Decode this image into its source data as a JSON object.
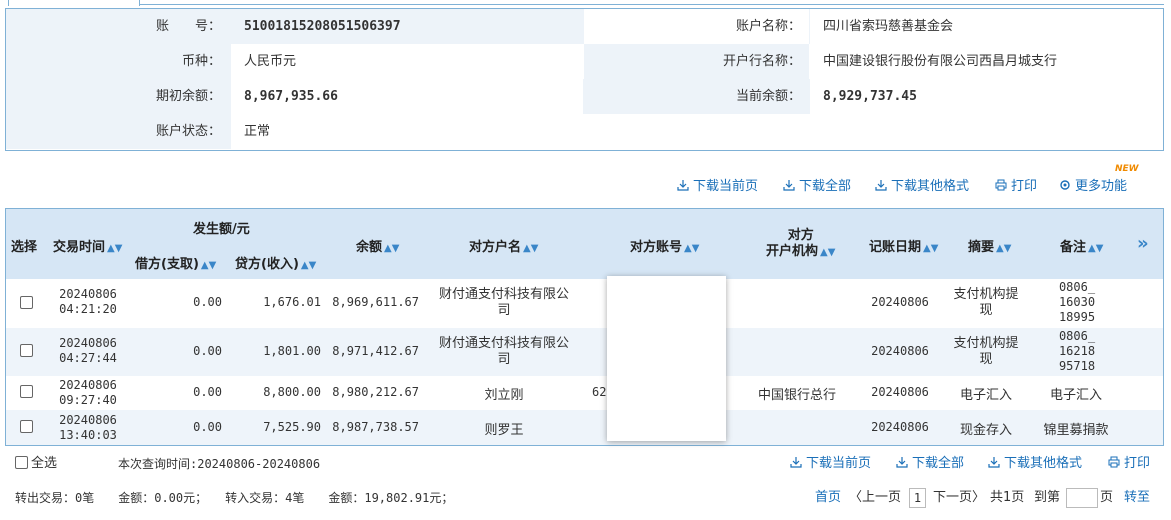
{
  "account": {
    "number_label": "账　　号：",
    "number_value": "51001815208051506397",
    "name_label": "账户名称：",
    "name_value": "四川省索玛慈善基金会",
    "currency_label": "币种：",
    "currency_value": "人民币元",
    "bank_label": "开户行名称：",
    "bank_value": "中国建设银行股份有限公司西昌月城支行",
    "opening_label": "期初余额：",
    "opening_value": "8,967,935.66",
    "current_label": "当前余额：",
    "current_value": "8,929,737.45",
    "status_label": "账户状态：",
    "status_value": "正常"
  },
  "toolbar": {
    "download_page": "下载当前页",
    "download_all": "下载全部",
    "download_other": "下载其他格式",
    "print": "打印",
    "more": "更多功能",
    "new_badge": "NEW"
  },
  "table": {
    "headers": {
      "select": "选择",
      "time": "交易时间",
      "amount_group": "发生额/元",
      "debit": "借方(支取)",
      "credit": "贷方(收入)",
      "balance": "余额",
      "counterparty_name": "对方户名",
      "counterparty_account": "对方账号",
      "counterparty_bank_1": "对方",
      "counterparty_bank_2": "开户机构",
      "post_date": "记账日期",
      "summary": "摘要",
      "remark": "备注",
      "more": "»"
    },
    "rows": [
      {
        "date": "20240806",
        "time": "04:21:20",
        "debit": "0.00",
        "credit": "1,676.01",
        "balance": "8,969,611.67",
        "name_1": "财付通支付科技有限公",
        "name_2": "司",
        "account": "",
        "bank": "",
        "post_date": "20240806",
        "summary_1": "支付机构提",
        "summary_2": "现",
        "remark_1": "0806_",
        "remark_2": "16030",
        "remark_3": "18995"
      },
      {
        "date": "20240806",
        "time": "04:27:44",
        "debit": "0.00",
        "credit": "1,801.00",
        "balance": "8,971,412.67",
        "name_1": "财付通支付科技有限公",
        "name_2": "司",
        "account": "",
        "bank": "",
        "post_date": "20240806",
        "summary_1": "支付机构提",
        "summary_2": "现",
        "remark_1": "0806_",
        "remark_2": "16218",
        "remark_3": "95718"
      },
      {
        "date": "20240806",
        "time": "09:27:40",
        "debit": "0.00",
        "credit": "8,800.00",
        "balance": "8,980,212.67",
        "name_1": "刘立刚",
        "name_2": "",
        "account": "62",
        "bank": "中国银行总行",
        "post_date": "20240806",
        "summary_1": "电子汇入",
        "summary_2": "",
        "remark_1": "电子汇入",
        "remark_2": "",
        "remark_3": ""
      },
      {
        "date": "20240806",
        "time": "13:40:03",
        "debit": "0.00",
        "credit": "7,525.90",
        "balance": "8,987,738.57",
        "name_1": "则罗王",
        "name_2": "",
        "account": "",
        "bank": "",
        "post_date": "20240806",
        "summary_1": "现金存入",
        "summary_2": "",
        "remark_1": "锦里募捐款",
        "remark_2": "",
        "remark_3": ""
      }
    ]
  },
  "footer": {
    "select_all": "全选",
    "query_time": "本次查询时间:20240806-20240806",
    "download_page": "下载当前页",
    "download_all": "下载全部",
    "download_other": "下载其他格式",
    "print": "打印",
    "summary_out": "转出交易：0笔　　金额：0.00元；　　转入交易：4笔　　金额：19,802.91元；",
    "first": "首页",
    "prev": "〈上一页",
    "page_num": "1",
    "next": "下一页〉",
    "total": "共1页",
    "goto": "到第",
    "page_unit": "页",
    "jump": "转至"
  },
  "colors": {
    "border": "#7fb1d6",
    "header_bg": "#d6e6f5",
    "row_alt": "#eef4fa",
    "link": "#1a6fb8",
    "badge": "#f08a00"
  }
}
